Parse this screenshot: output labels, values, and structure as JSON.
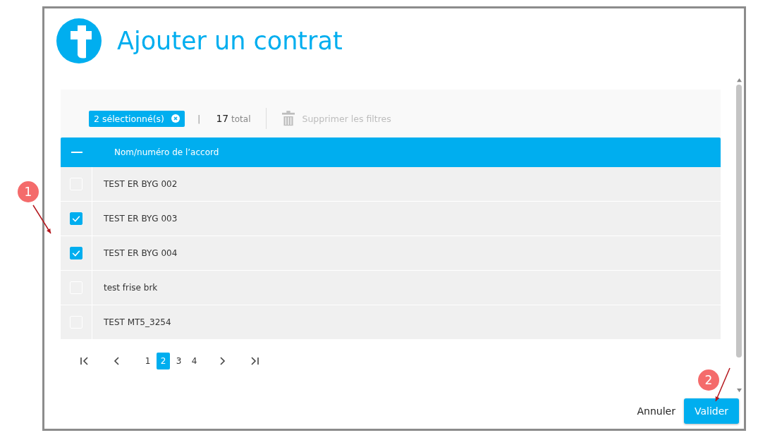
{
  "dialog": {
    "title": "Ajouter un contrat"
  },
  "toolbar": {
    "selection_chip": "2 sélectionné(s)",
    "separator": "|",
    "total_count": "17",
    "total_label": "total",
    "clear_filters": {
      "label": "Supprimer les filtres",
      "disabled": true
    }
  },
  "table": {
    "select_all": {
      "indeterminate": true
    },
    "columns": [
      "Nom/numéro de l’accord"
    ],
    "rows": [
      {
        "name": "TEST ER BYG 002",
        "checked": false
      },
      {
        "name": "TEST ER BYG 003",
        "checked": true
      },
      {
        "name": "TEST ER BYG 004",
        "checked": true
      },
      {
        "name": "test frise brk",
        "checked": false
      },
      {
        "name": "TEST MT5_3254",
        "checked": false
      }
    ]
  },
  "pagination": {
    "pages": [
      {
        "label": "1",
        "selected": false
      },
      {
        "label": "2",
        "selected": true
      },
      {
        "label": "3",
        "selected": false
      },
      {
        "label": "4",
        "selected": false
      }
    ]
  },
  "buttons": {
    "cancel": "Annuler",
    "confirm": "Valider"
  },
  "annotations": [
    {
      "label": "1"
    },
    {
      "label": "2"
    }
  ]
}
